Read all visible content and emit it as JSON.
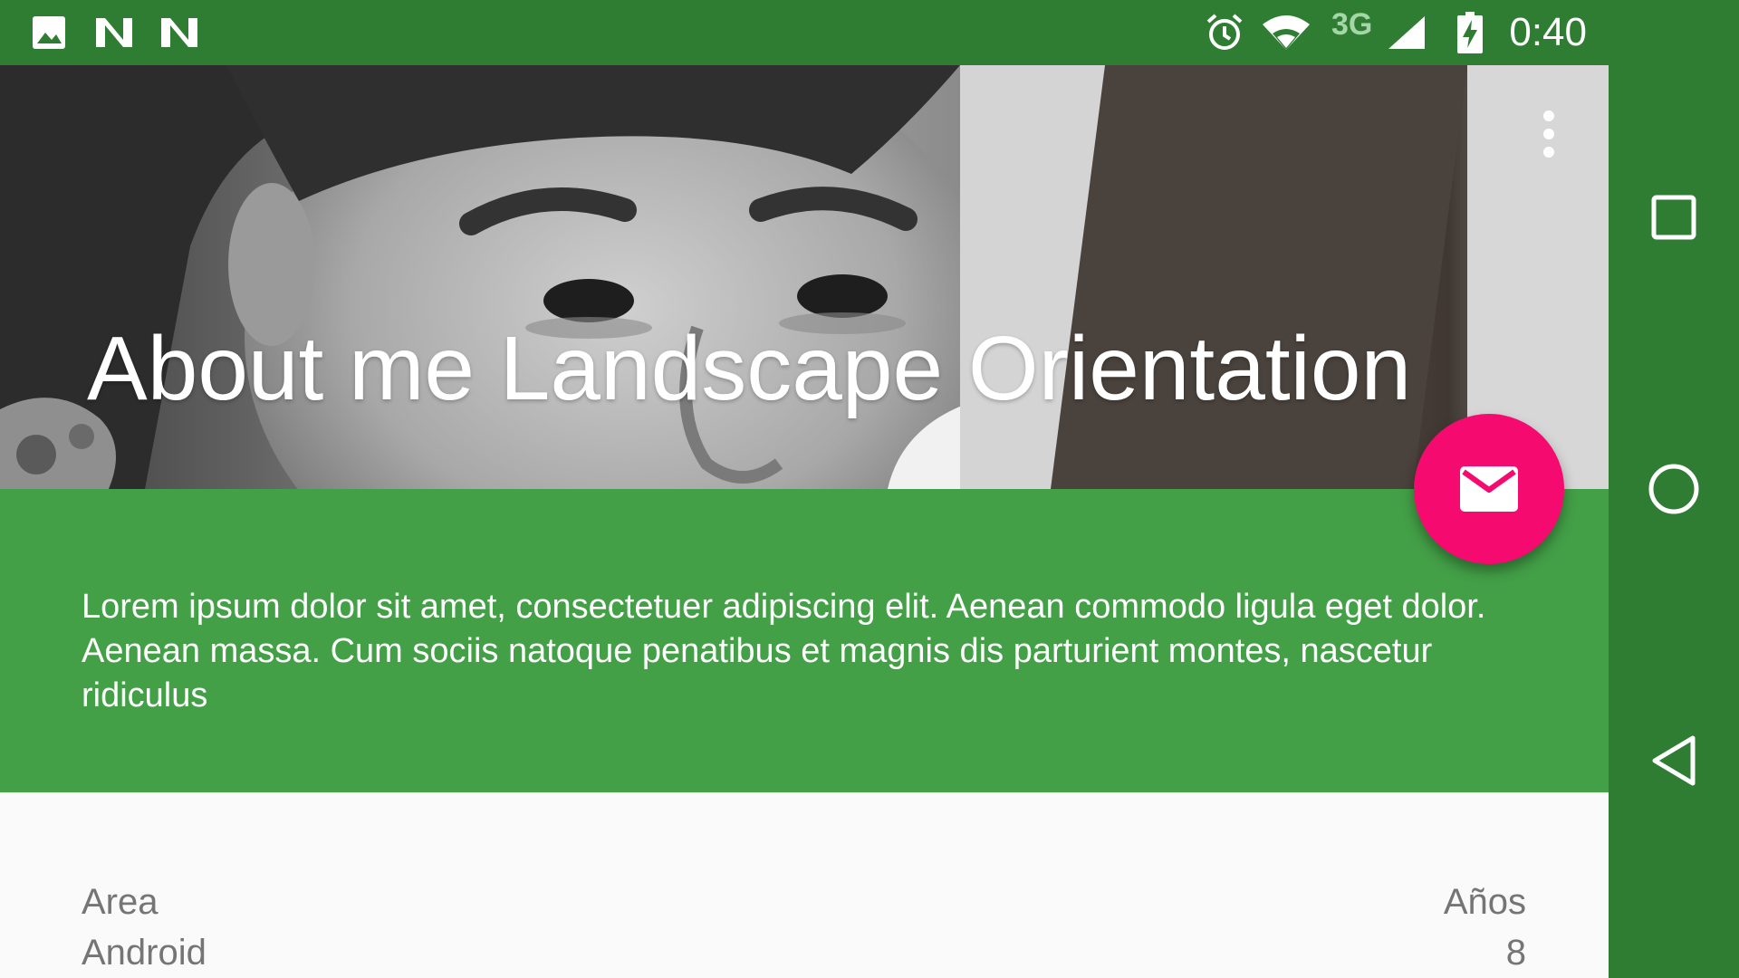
{
  "status_bar": {
    "time": "0:40",
    "network_label": "3G",
    "notification_icons": [
      "image-icon",
      "n-icon",
      "n-icon"
    ],
    "system_icons": [
      "alarm-icon",
      "wifi-icon",
      "cell-signal-icon",
      "battery-charging-icon"
    ]
  },
  "header": {
    "title": "About me Landscape Orientation",
    "menu_icon": "more-vert-icon"
  },
  "fab": {
    "icon": "email-icon",
    "color": "#f50b6f"
  },
  "about": {
    "description": "Lorem ipsum dolor sit amet, consectetuer adipiscing elit. Aenean commodo ligula eget dolor. Aenean massa. Cum sociis natoque penatibus et magnis dis parturient montes, nascetur ridiculus"
  },
  "skills": {
    "header": {
      "area": "Area",
      "years": "Años"
    },
    "rows": [
      {
        "area": "Android",
        "years": "8"
      }
    ]
  },
  "nav_bar": {
    "buttons": [
      "recents-icon",
      "home-icon",
      "back-icon"
    ]
  },
  "colors": {
    "status_bar": "#2e7d32",
    "panel": "#43a047",
    "accent": "#f50b6f",
    "background": "#fafafa",
    "secondary_text": "#757575"
  }
}
